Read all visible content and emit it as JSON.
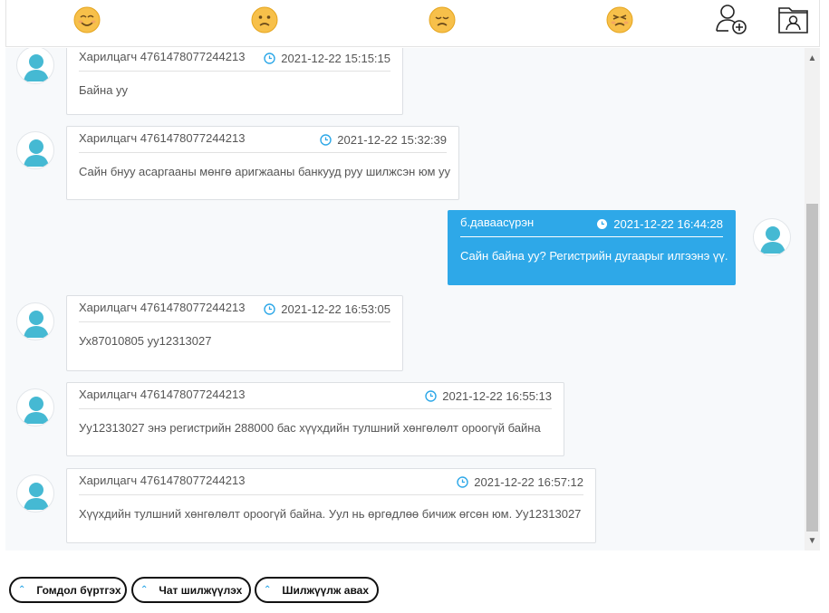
{
  "toolbar": {
    "emojis": [
      "smiling-face",
      "confused-face",
      "disappointed-face",
      "persevering-face"
    ],
    "actions": [
      "add-user-icon",
      "contact-folder-icon"
    ]
  },
  "messages": [
    {
      "direction": "in",
      "sender": "Харилцагч 4761478077244213",
      "time": "2021-12-22 15:15:15",
      "text": "Байна уу"
    },
    {
      "direction": "in",
      "sender": "Харилцагч 4761478077244213",
      "time": "2021-12-22 15:32:39",
      "text": "Сайн бнуу асаргааны мөнгө аригжааны банкууд руу шилжсэн юм уу"
    },
    {
      "direction": "out",
      "sender": "б.даваасүрэн",
      "time": "2021-12-22 16:44:28",
      "text": "Сайн байна уу? Регистрийн дугаарыг илгээнэ үү."
    },
    {
      "direction": "in",
      "sender": "Харилцагч 4761478077244213",
      "time": "2021-12-22 16:53:05",
      "text": "Ух87010805 уу12313027"
    },
    {
      "direction": "in",
      "sender": "Харилцагч 4761478077244213",
      "time": "2021-12-22 16:55:13",
      "text": "Уу12313027 энэ регистрийн 288000 бас хүүхдийн тулшний хөнгөлөлт ороогүй байна"
    },
    {
      "direction": "in",
      "sender": "Харилцагч 4761478077244213",
      "time": "2021-12-22 16:57:12",
      "text": "Хүүхдийн тулшний хөнгөлөлт ороогүй байна. Уул нь өргөдлөө бичиж өгсөн юм. Уу12313027"
    }
  ],
  "buttons": {
    "complaint": "Гомдол бүртгэх",
    "transfer_chat": "Чат шилжүүлэх",
    "receive_transfer": "Шилжүүлж авах"
  },
  "colors": {
    "outgoing_bubble": "#2ea8e8",
    "avatar": "#45b9d3"
  }
}
